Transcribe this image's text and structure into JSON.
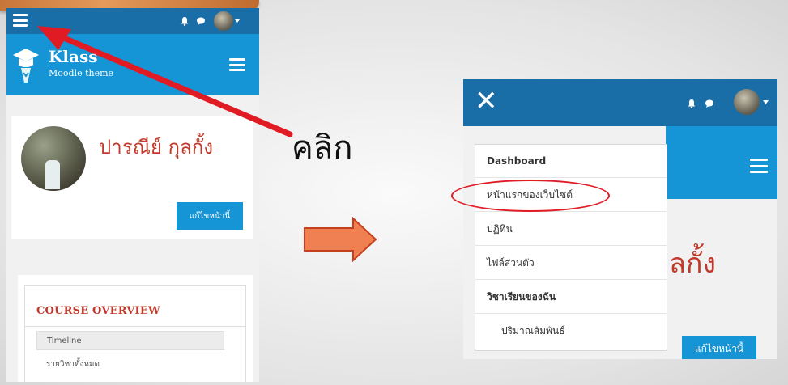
{
  "annotation": {
    "click_label": "คลิก"
  },
  "left_screen": {
    "logo": {
      "title": "Klass",
      "subtitle": "Moodle theme"
    },
    "profile": {
      "name": "ปารณีย์ กุลกั้ง",
      "edit_button": "แก้ไขหน้านี้"
    },
    "course_overview": {
      "title": "COURSE OVERVIEW",
      "tab": "Timeline",
      "filter": "รายวิชาทั้งหมด"
    },
    "icons": [
      "menu-icon",
      "bell-icon",
      "chat-icon",
      "avatar",
      "hamburger-icon"
    ]
  },
  "right_screen": {
    "drawer_items": [
      {
        "label": "Dashboard",
        "bold": true
      },
      {
        "label": "หน้าแรกของเว็บไซต์",
        "highlighted": true
      },
      {
        "label": "ปฏิทิน"
      },
      {
        "label": "ไฟล์ส่วนตัว"
      },
      {
        "label": "วิชาเรียนของฉัน",
        "bold": true
      },
      {
        "label": "ปริมาณสัมพันธ์",
        "indent": true
      }
    ],
    "name_fragment": "ุลกั้ง",
    "edit_fragment": "แก้ไขหน้านี้",
    "icons": [
      "close-icon",
      "bell-icon",
      "chat-icon",
      "avatar",
      "hamburger-icon"
    ]
  },
  "colors": {
    "topbar": "#1a6ea8",
    "header": "#1594d6",
    "name_red": "#c0392b",
    "arrow_red": "#e01b24"
  }
}
